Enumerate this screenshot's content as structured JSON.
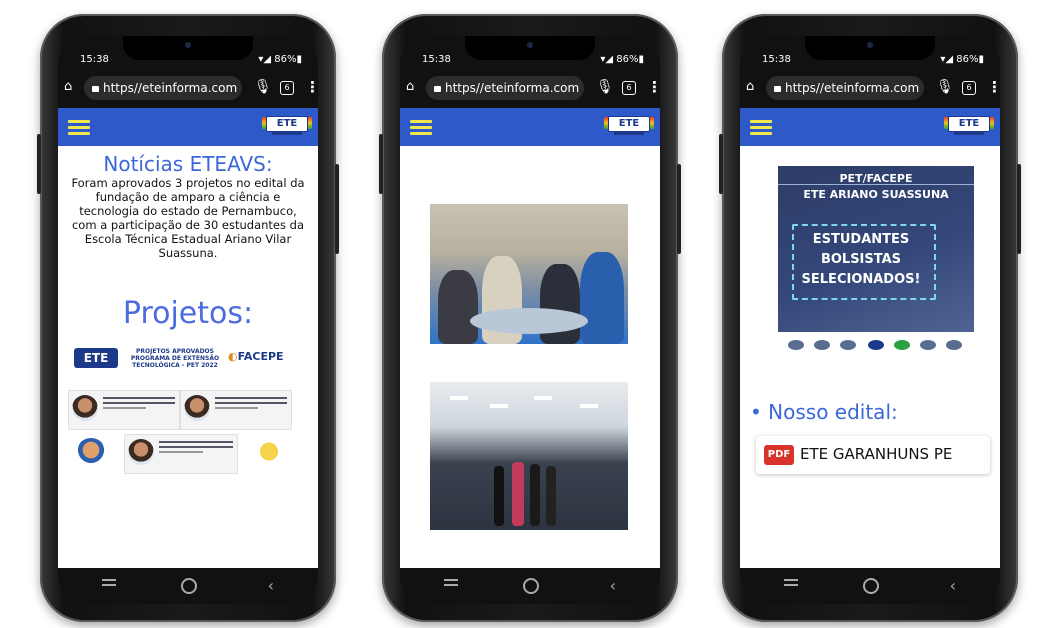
{
  "status": {
    "time": "15:38",
    "battery": "86%"
  },
  "browser": {
    "url": "https//eteinforma.com",
    "tab_count": "6"
  },
  "site": {
    "logo_text": "ETE"
  },
  "phone1": {
    "news_title": "Notícias ETEAVS:",
    "news_body": "Foram aprovados 3 projetos no edital da fundação de amparo a ciência e tecnologia do estado de Pernambuco, com a participação de 30 estudantes da Escola Técnica Estadual Ariano Vilar Suassuna.",
    "projects_title": "Projetos:",
    "card_logo": "ETE",
    "card_text": "PROJETOS APROVADOS PROGRAMA DE EXTENSÃO TECNOLÓGICA - PET 2022",
    "card_partner": "FACEPE"
  },
  "phone3": {
    "poster_line1": "PET/FACEPE",
    "poster_line2": "ETE ARIANO SUASSUNA",
    "poster_b1": "ESTUDANTES",
    "poster_b2": "BOLSISTAS",
    "poster_b3": "SELECIONADOS!",
    "edital_heading": "• Nosso edital:",
    "pdf_tag": "PDF",
    "pdf_label": "ETE GARANHUNS PE"
  }
}
